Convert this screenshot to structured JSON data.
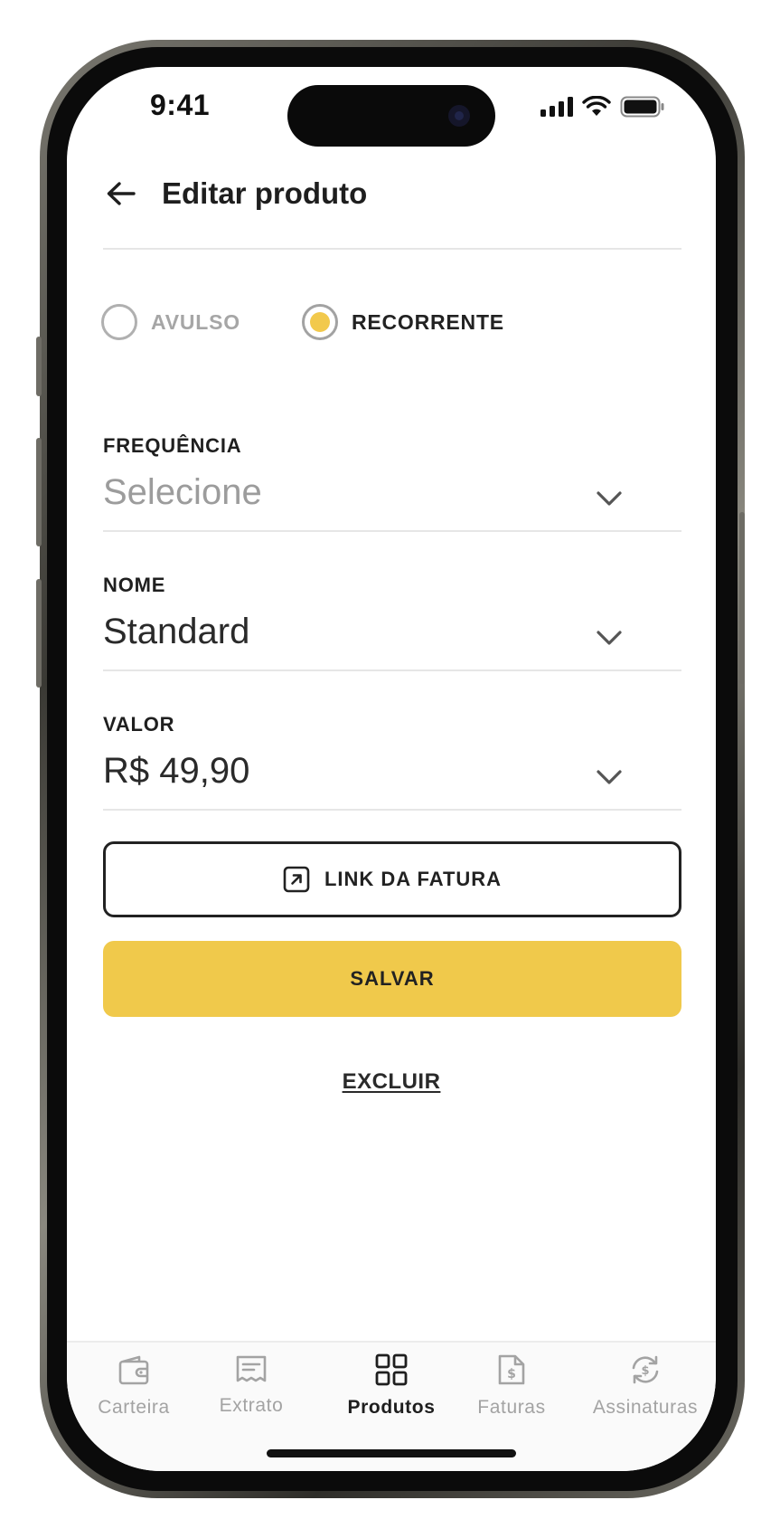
{
  "status_bar": {
    "time": "9:41"
  },
  "header": {
    "title": "Editar produto"
  },
  "type_selector": {
    "options": [
      {
        "label": "AVULSO",
        "selected": false
      },
      {
        "label": "RECORRENTE",
        "selected": true
      }
    ]
  },
  "fields": {
    "frequencia": {
      "label": "FREQUÊNCIA",
      "placeholder": "Selecione"
    },
    "nome": {
      "label": "NOME",
      "value": "Standard"
    },
    "valor": {
      "label": "VALOR",
      "value": "R$ 49,90"
    }
  },
  "actions": {
    "invoice_link_label": "LINK DA FATURA",
    "save_label": "SALVAR",
    "delete_label": "EXCLUIR"
  },
  "tabbar": {
    "items": [
      {
        "label": "Carteira",
        "icon": "wallet-icon",
        "active": false
      },
      {
        "label": "Extrato",
        "icon": "receipt-icon",
        "active": false
      },
      {
        "label": "Produtos",
        "icon": "grid-icon",
        "active": true
      },
      {
        "label": "Faturas",
        "icon": "invoice-dollar-icon",
        "active": false
      },
      {
        "label": "Assinaturas",
        "icon": "subscription-cycle-icon",
        "active": false
      }
    ]
  },
  "colors": {
    "accent": "#F0C94B",
    "text_primary": "#1E1E1E",
    "text_muted": "#A3A3A3",
    "divider": "#E6E6E6"
  }
}
